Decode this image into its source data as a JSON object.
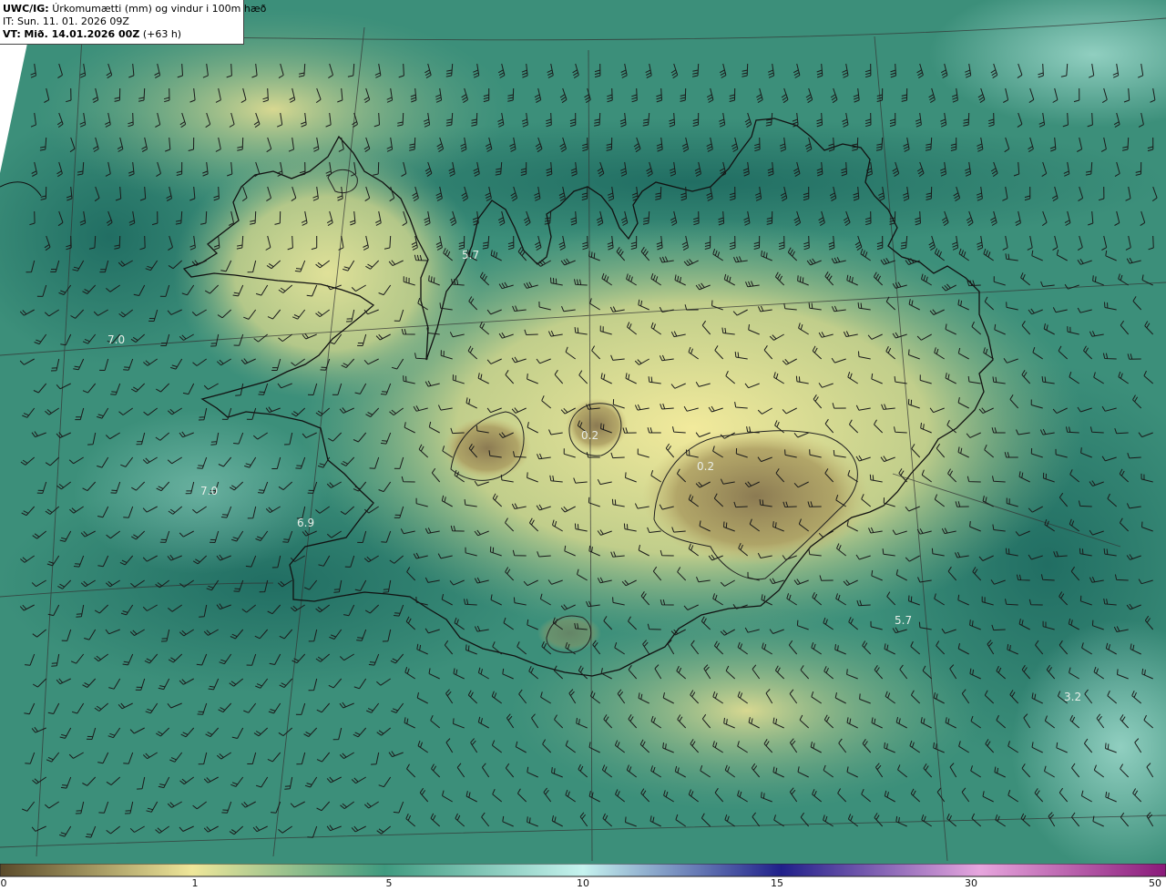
{
  "header": {
    "model": "UWC/IG:",
    "title": "Úrkomumætti (mm) og vindur i 100m hæð",
    "init_time": "IT: Sun. 11. 01. 2026 09Z",
    "valid_label": "VT:",
    "valid_time": "Mið. 14.01.2026 00Z",
    "lead": "(+63 h)"
  },
  "map_labels": [
    {
      "text": "5.7"
    },
    {
      "text": "7.0"
    },
    {
      "text": "7.0"
    },
    {
      "text": "6.9"
    },
    {
      "text": "0.2"
    },
    {
      "text": "0.2"
    },
    {
      "text": "5.7"
    },
    {
      "text": "3.2"
    }
  ],
  "colorbar": {
    "ticks": [
      "0",
      "1",
      "5",
      "10",
      "15",
      "30",
      "50"
    ],
    "colors": [
      "#5a4a2a",
      "#b7a570",
      "#efe79a",
      "#4a9a82",
      "#bfeff0",
      "#2a2a9a",
      "#d080c8",
      "#8a1a7a"
    ]
  },
  "colors": {
    "land_high": "#efe79a",
    "sea_mid": "#3f9a7f",
    "sea_deep": "#1f6f63",
    "dry": "#8b7a52"
  }
}
